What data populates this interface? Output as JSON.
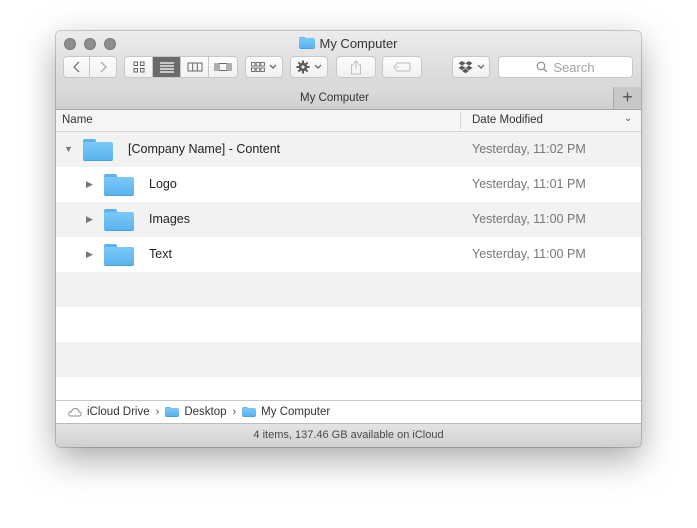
{
  "window": {
    "title": "My Computer",
    "title_icon": "folder-icon"
  },
  "toolbar": {
    "back_icon": "chevron-left-icon",
    "forward_icon": "chevron-right-icon",
    "view_modes": [
      {
        "name": "icon-view",
        "icon": "grid-icon",
        "active": false
      },
      {
        "name": "list-view",
        "icon": "list-icon",
        "active": true
      },
      {
        "name": "column-view",
        "icon": "columns-icon",
        "active": false
      },
      {
        "name": "cover-flow-view",
        "icon": "cover-flow-icon",
        "active": false
      }
    ],
    "arrange_icon": "arrange-icon",
    "action_icon": "gear-icon",
    "share_icon": "share-icon",
    "tags_icon": "tag-icon",
    "dropbox_icon": "dropbox-icon",
    "search_placeholder": "Search"
  },
  "tabbar": {
    "tab_label": "My Computer",
    "add_tab": "+"
  },
  "columns": {
    "name": "Name",
    "date_modified": "Date Modified"
  },
  "rows": [
    {
      "name": "[Company Name] - Content",
      "date": "Yesterday, 11:02 PM",
      "expanded": true,
      "level": 0
    },
    {
      "name": "Logo",
      "date": "Yesterday, 11:01 PM",
      "expanded": false,
      "level": 1
    },
    {
      "name": "Images",
      "date": "Yesterday, 11:00 PM",
      "expanded": false,
      "level": 1
    },
    {
      "name": "Text",
      "date": "Yesterday, 11:00 PM",
      "expanded": false,
      "level": 1
    }
  ],
  "pathbar": {
    "items": [
      "iCloud Drive",
      "Desktop",
      "My Computer"
    ],
    "separator": "›"
  },
  "status": {
    "text": "4 items, 137.46 GB available on iCloud"
  },
  "colors": {
    "folder_blue": "#6cbff5",
    "active_segment": "#6b6b6b",
    "row_alt": "#f2f2f2"
  }
}
